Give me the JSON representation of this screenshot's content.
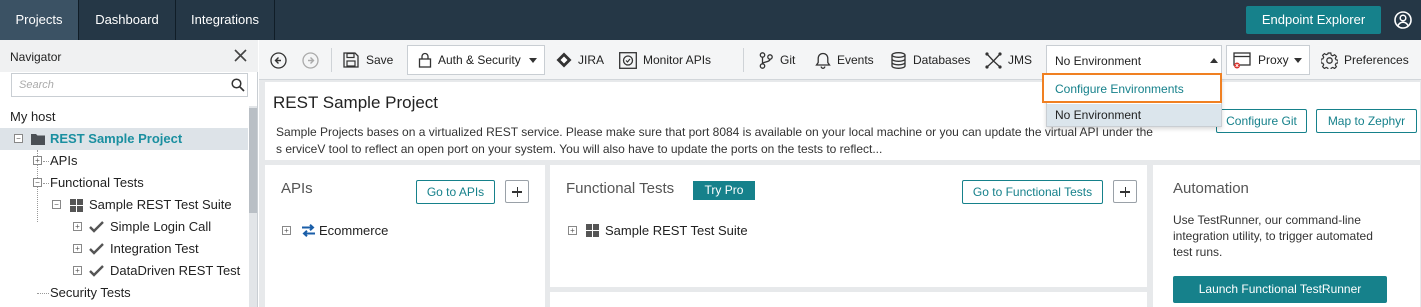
{
  "topnav": {
    "tabs": [
      "Projects",
      "Dashboard",
      "Integrations"
    ],
    "endpoint_explorer": "Endpoint Explorer"
  },
  "navigator": {
    "title": "Navigator",
    "search_placeholder": "Search",
    "tree": {
      "host": "My host",
      "project": "REST Sample Project",
      "apis": "APIs",
      "functional_tests": "Functional Tests",
      "suite": "Sample REST Test Suite",
      "tests": [
        "Simple Login Call",
        "Integration Test",
        "DataDriven REST Test"
      ],
      "security_tests": "Security Tests"
    }
  },
  "toolbar": {
    "save": "Save",
    "auth_security": "Auth & Security",
    "jira": "JIRA",
    "monitor_apis": "Monitor APIs",
    "git": "Git",
    "events": "Events",
    "databases": "Databases",
    "jms": "JMS",
    "environment": "No Environment",
    "proxy": "Proxy",
    "preferences": "Preferences"
  },
  "env_dropdown": {
    "options": [
      "Configure Environments",
      "No Environment"
    ]
  },
  "project": {
    "title": "REST Sample Project",
    "description": "Sample Projects bases on a virtualized REST service. Please make sure that port 8084 is available on your local machine or you can update the virtual API under the s erviceV tool to reflect an open port on your system. You will also have to update the ports on the tests to reflect...",
    "configure_git": "Configure Git",
    "map_to_zephyr": "Map to Zephyr"
  },
  "apis_panel": {
    "title": "APIs",
    "go_button": "Go to APIs",
    "items": [
      "Ecommerce"
    ]
  },
  "functional_panel": {
    "title": "Functional Tests",
    "badge": "Try Pro",
    "go_button": "Go to Functional Tests",
    "items": [
      "Sample REST Test Suite"
    ]
  },
  "automation_panel": {
    "title": "Automation",
    "description": "Use TestRunner, our command-line integration utility, to trigger automated test runs.",
    "button": "Launch Functional TestRunner"
  },
  "colors": {
    "topbar": "#253746",
    "accent": "#16818b",
    "highlight": "#f08022",
    "project_text": "#1a8fa0"
  }
}
